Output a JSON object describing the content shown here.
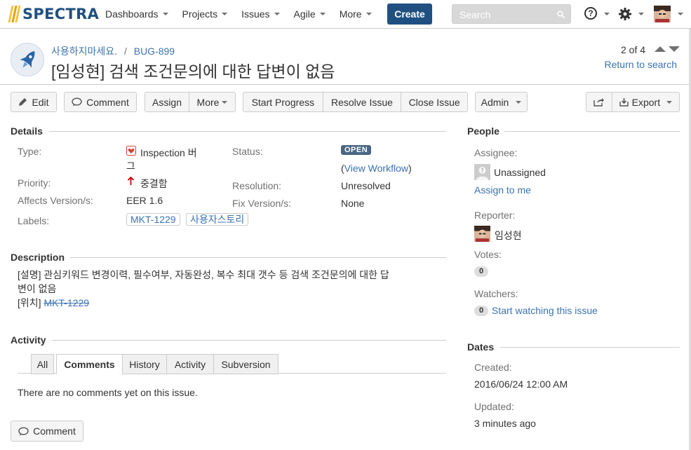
{
  "app": {
    "brand": "SPECTRA"
  },
  "nav": {
    "items": [
      "Dashboards",
      "Projects",
      "Issues",
      "Agile",
      "More"
    ],
    "create_label": "Create",
    "search_placeholder": "Search"
  },
  "breadcrumb": {
    "project": "사용하지마세요.",
    "separator": "/",
    "issue_key": "BUG-899"
  },
  "issue": {
    "title": "[임성현] 검색 조건문의에 대한 답변이 없음"
  },
  "pager": {
    "text": "2 of 4",
    "return_label": "Return to search"
  },
  "toolbar": {
    "edit": "Edit",
    "comment": "Comment",
    "assign": "Assign",
    "more": "More",
    "start_progress": "Start Progress",
    "resolve": "Resolve Issue",
    "close": "Close Issue",
    "admin": "Admin",
    "export": "Export"
  },
  "details": {
    "section_title": "Details",
    "type_label": "Type:",
    "type_value_line1": "Inspection 버",
    "type_value_line2": "그",
    "status_label": "Status:",
    "status_value": "OPEN",
    "workflow_open": "(",
    "workflow_link": "View Workflow",
    "workflow_close": ")",
    "priority_label": "Priority:",
    "priority_value": "중결함",
    "resolution_label": "Resolution:",
    "resolution_value": "Unresolved",
    "affects_label": "Affects Version/s:",
    "affects_value": "EER 1.6",
    "fix_label": "Fix Version/s:",
    "fix_value": "None",
    "labels_label": "Labels:",
    "labels": [
      "MKT-1229",
      "사용자스토리"
    ]
  },
  "description": {
    "section_title": "Description",
    "line1": "[설명] 관심키워드 변경이력, 필수여부, 자동완성, 복수 최대 갯수 등 검색 조건문의에 대한 답",
    "line2": "변이 없음",
    "line3_prefix": "[위치] ",
    "line3_link": "MKT-1229"
  },
  "activity": {
    "section_title": "Activity",
    "tabs": [
      "All",
      "Comments",
      "History",
      "Activity",
      "Subversion"
    ],
    "active_tab": "Comments",
    "empty_text": "There are no comments yet on this issue.",
    "comment_button": "Comment"
  },
  "people": {
    "section_title": "People",
    "assignee_label": "Assignee:",
    "assignee_value": "Unassigned",
    "assign_to_me": "Assign to me",
    "reporter_label": "Reporter:",
    "reporter_value": "임성현",
    "votes_label": "Votes:",
    "votes_count": "0",
    "watchers_label": "Watchers:",
    "watchers_count": "0",
    "watch_link": "Start watching this issue"
  },
  "dates": {
    "section_title": "Dates",
    "created_label": "Created:",
    "created_value": "2016/06/24 12:00 AM",
    "updated_label": "Updated:",
    "updated_value": "3 minutes ago"
  },
  "colors": {
    "brand": "#205081",
    "link": "#3b73af",
    "status_open": "#4a6785",
    "priority_up": "#cc0000"
  }
}
